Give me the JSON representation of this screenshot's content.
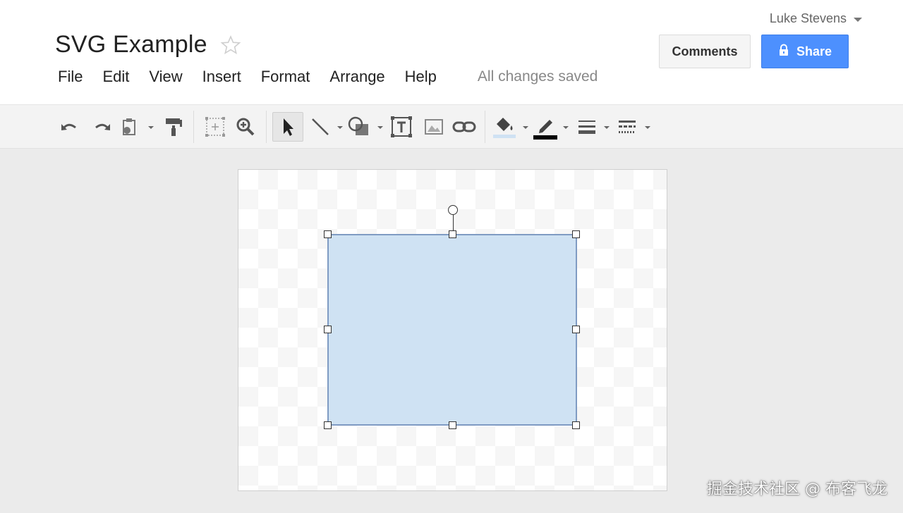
{
  "header": {
    "user_name": "Luke Stevens",
    "doc_title": "SVG Example",
    "comments_label": "Comments",
    "share_label": "Share",
    "save_status": "All changes saved"
  },
  "menu": {
    "items": [
      "File",
      "Edit",
      "View",
      "Insert",
      "Format",
      "Arrange",
      "Help"
    ]
  },
  "toolbar": {
    "icons": [
      "undo-icon",
      "redo-icon",
      "paste-format-icon",
      "paint-format-icon",
      "select-all-icon",
      "zoom-icon",
      "select-arrow-icon",
      "line-icon",
      "shape-icon",
      "text-box-icon",
      "image-icon",
      "link-icon",
      "fill-color-icon",
      "line-color-icon",
      "line-weight-icon",
      "line-dash-icon"
    ],
    "fill_color": "#cfe2f3",
    "line_color": "#000000"
  },
  "canvas": {
    "shape_fill": "#cfe2f3",
    "shape_border": "#7f9bc3",
    "accent": "#4d90fe"
  },
  "watermark": {
    "text": "掘金技术社区 @ 布客飞龙"
  }
}
